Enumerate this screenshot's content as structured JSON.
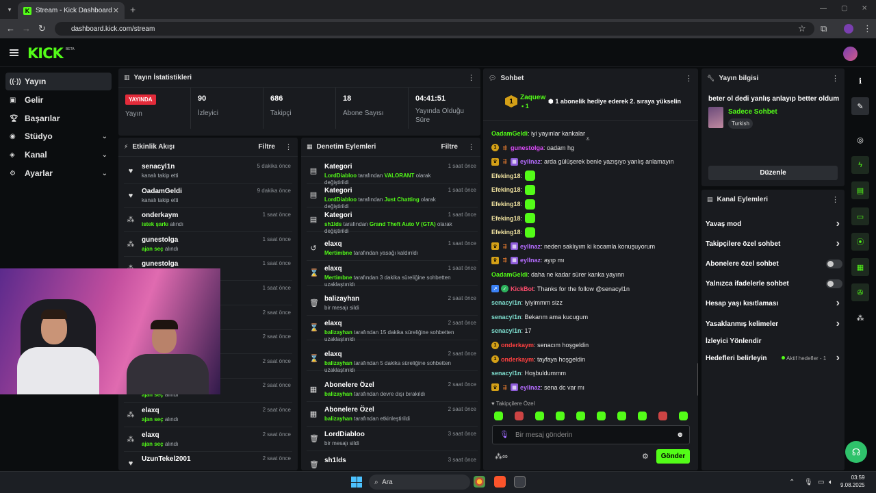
{
  "browser": {
    "tab_title": "Stream - Kick Dashboard",
    "url": "dashboard.kick.com/stream"
  },
  "app": {
    "logo": "KICK",
    "beta": "BETA"
  },
  "sidebar": {
    "items": [
      {
        "label": "Yayın",
        "icon": "broadcast-icon"
      },
      {
        "label": "Gelir",
        "icon": "wallet-icon"
      },
      {
        "label": "Başarılar",
        "icon": "trophy-icon"
      },
      {
        "label": "Stüdyo",
        "icon": "studio-icon"
      },
      {
        "label": "Kanal",
        "icon": "channel-icon"
      },
      {
        "label": "Ayarlar",
        "icon": "gear-icon"
      }
    ]
  },
  "stats": {
    "title": "Yayın İstatistikleri",
    "live": "YAYINDA",
    "status_label": "Yayın",
    "viewers": "90",
    "viewers_label": "İzleyici",
    "followers": "686",
    "followers_label": "Takipçi",
    "subs": "18",
    "subs_label": "Abone Sayısı",
    "uptime": "04:41:51",
    "uptime_label": "Yayında Olduğu Süre"
  },
  "activity": {
    "title": "Etkinlik Akışı",
    "filter": "Filtre",
    "items": [
      {
        "name": "senacyl1n",
        "sub_pre": "",
        "sub_green": "",
        "sub": "kanalı takip etti",
        "time": "5 dakika önce"
      },
      {
        "name": "OadamGeldi",
        "sub_pre": "",
        "sub_green": "",
        "sub": "kanalı takip etti",
        "time": "9 dakika önce"
      },
      {
        "name": "onderkaym",
        "sub_green": "istek şarkı",
        "sub": "alındı",
        "time": "1 saat önce"
      },
      {
        "name": "gunestolga",
        "sub_green": "ajan seç",
        "sub": "alındı",
        "time": "1 saat önce"
      },
      {
        "name": "gunestolga",
        "sub_green": "",
        "sub": "",
        "time": "1 saat önce"
      },
      {
        "name": "",
        "sub_green": "",
        "sub": "",
        "time": "1 saat önce"
      },
      {
        "name": "",
        "sub_green": "",
        "sub": "",
        "time": "2 saat önce"
      },
      {
        "name": "",
        "sub_green": "",
        "sub": "",
        "time": "2 saat önce"
      },
      {
        "name": "",
        "sub_green": "",
        "sub": "",
        "time": "2 saat önce"
      },
      {
        "name": "",
        "sub_green": "ajan seç",
        "sub": "alındı",
        "time": "2 saat önce"
      },
      {
        "name": "elaxq",
        "sub_green": "ajan seç",
        "sub": "alındı",
        "time": "2 saat önce"
      },
      {
        "name": "elaxq",
        "sub_green": "ajan seç",
        "sub": "alındı",
        "time": "2 saat önce"
      },
      {
        "name": "UzunTekel2001",
        "sub_green": "",
        "sub": "",
        "time": "2 saat önce"
      }
    ]
  },
  "moderation": {
    "title": "Denetim Eylemleri",
    "filter": "Filtre",
    "items": [
      {
        "name": "Kategori",
        "g1": "LordDiabloo",
        "t1": " tarafından ",
        "g2": "VALORANT",
        "t2": " olarak değiştirildi",
        "time": "1 saat önce"
      },
      {
        "name": "Kategori",
        "g1": "LordDiabloo",
        "t1": " tarafından ",
        "g2": "Just Chatting",
        "t2": " olarak değiştirildi",
        "time": "1 saat önce"
      },
      {
        "name": "Kategori",
        "g1": "sh1lds",
        "t1": " tarafından ",
        "g2": "Grand Theft Auto V (GTA)",
        "t2": " olarak değiştirildi",
        "time": "1 saat önce"
      },
      {
        "name": "elaxq",
        "g1": "Mertimbne",
        "t1": " tarafından yasağı kaldırıldı",
        "g2": "",
        "t2": "",
        "time": "1 saat önce"
      },
      {
        "name": "elaxq",
        "g1": "Mertimbne",
        "t1": " tarafından 3 dakika süreliğine sohbetten uzaklaştırıldı",
        "g2": "",
        "t2": "",
        "time": "1 saat önce"
      },
      {
        "name": "balizayhan",
        "g1": "",
        "t1": "bir mesajı sildi",
        "g2": "",
        "t2": "",
        "time": "2 saat önce"
      },
      {
        "name": "elaxq",
        "g1": "balizayhan",
        "t1": " tarafından 15 dakika süreliğine sohbetten uzaklaştırıldı",
        "g2": "",
        "t2": "",
        "time": "2 saat önce"
      },
      {
        "name": "elaxq",
        "g1": "balizayhan",
        "t1": " tarafından 5 dakika süreliğine sohbetten uzaklaştırıldı",
        "g2": "",
        "t2": "",
        "time": "2 saat önce"
      },
      {
        "name": "Abonelere Özel",
        "g1": "balizayhan",
        "t1": " tarafından devre dışı bırakıldı",
        "g2": "",
        "t2": "",
        "time": "2 saat önce"
      },
      {
        "name": "Abonelere Özel",
        "g1": "balizayhan",
        "t1": " tarafından etkinleştirildi",
        "g2": "",
        "t2": "",
        "time": "2 saat önce"
      },
      {
        "name": "LordDiabloo",
        "g1": "",
        "t1": "bir mesajı sildi",
        "g2": "",
        "t2": "",
        "time": "3 saat önce"
      },
      {
        "name": "sh1lds",
        "g1": "",
        "t1": "",
        "g2": "",
        "t2": "",
        "time": "3 saat önce"
      }
    ]
  },
  "chat": {
    "title": "Sohbet",
    "pinned_user": "Zaquew",
    "pinned_count": "1",
    "pinned_text": "1 abonelik hediye ederek 2. sıraya yükselin",
    "messages": [
      {
        "user": "OadamGeldi",
        "color": "#53fc18",
        "text": ": iyi yayınlar kankalar",
        "badges": ""
      },
      {
        "user": "gunestolga",
        "color": "#e04cff",
        "text": ": oadam hg",
        "badges": "gold,orange"
      },
      {
        "user": "eyllnaz",
        "color": "#b56cff",
        "text": ": arda gülüşerek benle yazışıyo yanlış anlamayın",
        "badges": "crown,orange,purple"
      },
      {
        "user": "Efeking18",
        "color": "#f1e3a0",
        "text": ":",
        "badges": "",
        "emote": true
      },
      {
        "user": "Efeking18",
        "color": "#f1e3a0",
        "text": ":",
        "badges": "",
        "emote": true
      },
      {
        "user": "Efeking18",
        "color": "#f1e3a0",
        "text": ":",
        "badges": "",
        "emote": true
      },
      {
        "user": "Efeking18",
        "color": "#f1e3a0",
        "text": ":",
        "badges": "",
        "emote": true
      },
      {
        "user": "Efeking18",
        "color": "#f1e3a0",
        "text": ":",
        "badges": "",
        "emote": true
      },
      {
        "user": "eyllnaz",
        "color": "#b56cff",
        "text": ": neden saklıyım ki kocamla konuşuyorum",
        "badges": "crown,orange,purple"
      },
      {
        "user": "eyllnaz",
        "color": "#b56cff",
        "text": ": ayıp mı",
        "badges": "crown,orange,purple"
      },
      {
        "user": "OadamGeldi",
        "color": "#53fc18",
        "text": ": daha ne kadar sürer kanka yayınn",
        "badges": ""
      },
      {
        "user": "KickBot",
        "color": "#ff4d6d",
        "text": ": Thanks for the follow @senacyl1n",
        "badges": "blue,green"
      },
      {
        "user": "senacyl1n",
        "color": "#7fe0d0",
        "text": ": iyiyimmm sizz",
        "badges": ""
      },
      {
        "user": "senacyl1n",
        "color": "#7fe0d0",
        "text": ": Bekarım ama kucugum",
        "badges": ""
      },
      {
        "user": "senacyl1n",
        "color": "#7fe0d0",
        "text": ": 17",
        "badges": ""
      },
      {
        "user": "onderkaym",
        "color": "#ff4040",
        "text": ": senacım hoşgeldin",
        "badges": "gold"
      },
      {
        "user": "onderkaym",
        "color": "#ff4040",
        "text": ": tayfaya hoşgeldin",
        "badges": "gold"
      },
      {
        "user": "senacyl1n",
        "color": "#7fe0d0",
        "text": ": Hoşbuldummm",
        "badges": ""
      },
      {
        "user": "eyllnaz",
        "color": "#b56cff",
        "text": ": sena dc var mı",
        "badges": "crown,orange,purple"
      }
    ],
    "followers_only": "Takipçilere Özel",
    "placeholder": "Bir mesaj gönderin",
    "send": "Gönder"
  },
  "info": {
    "title": "Yayın bilgisi",
    "stream_title": "beter ol dedi yanlış anlayıp better oldum",
    "category": "Sadece Sohbet",
    "tag": "Turkish",
    "edit": "Düzenle"
  },
  "channel": {
    "title": "Kanal Eylemleri",
    "rows": [
      {
        "label": "Yavaş mod",
        "kind": "chev"
      },
      {
        "label": "Takipçilere özel sohbet",
        "kind": "chev"
      },
      {
        "label": "Abonelere özel sohbet",
        "kind": "toggle"
      },
      {
        "label": "Yalnızca ifadelerle sohbet",
        "kind": "toggle"
      },
      {
        "label": "Hesap yaşı kısıtlaması",
        "kind": "chev"
      },
      {
        "label": "Yasaklanmış kelimeler",
        "kind": "chev"
      },
      {
        "label": "İzleyici Yönlendir",
        "kind": "none"
      },
      {
        "label": "Hedefleri belirleyin",
        "kind": "chev"
      }
    ],
    "goals_status": "Aktif hedefler - 1"
  },
  "taskbar": {
    "search": "Ara",
    "time": "03:59",
    "date": "9.08.2025"
  }
}
